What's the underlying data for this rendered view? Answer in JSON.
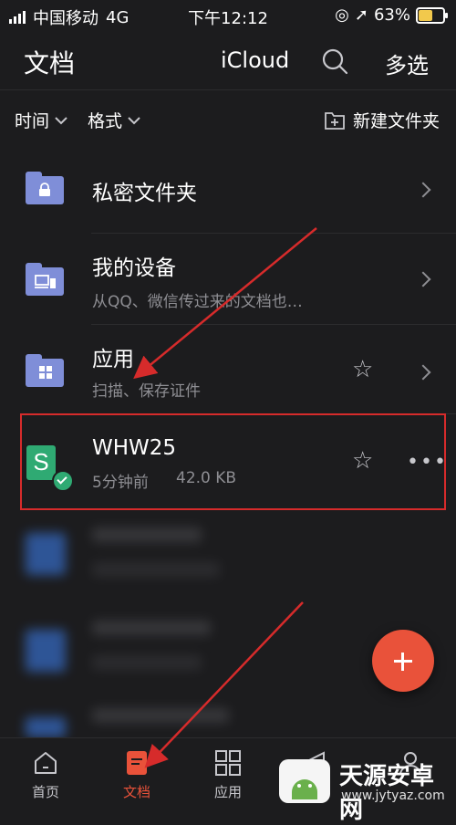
{
  "status": {
    "carrier": "中国移动",
    "network": "4G",
    "time": "下午12:12",
    "battery": "63%",
    "battery_level": 0.63
  },
  "header": {
    "title": "文档",
    "icloud": "iCloud",
    "multiselect": "多选"
  },
  "filters": {
    "time": "时间",
    "format": "格式",
    "new_folder": "新建文件夹"
  },
  "rows": [
    {
      "title": "私密文件夹"
    },
    {
      "title": "我的设备",
      "subtitle": "从QQ、微信传过来的文档也…"
    },
    {
      "title": "应用",
      "subtitle": "扫描、保存证件"
    }
  ],
  "file": {
    "name": "WHW25",
    "meta_time": "5分钟前",
    "meta_size": "42.0 KB",
    "icon_letter": "S"
  },
  "tabs": {
    "home": "首页",
    "docs": "文档",
    "apps": "应用"
  },
  "watermark": {
    "brand": "天源安卓网",
    "url": "www.jytyaz.com"
  },
  "colors": {
    "accent": "#e9523a",
    "folder": "#7f8ed8",
    "file": "#2faa73",
    "highlight": "#d62b2b"
  }
}
